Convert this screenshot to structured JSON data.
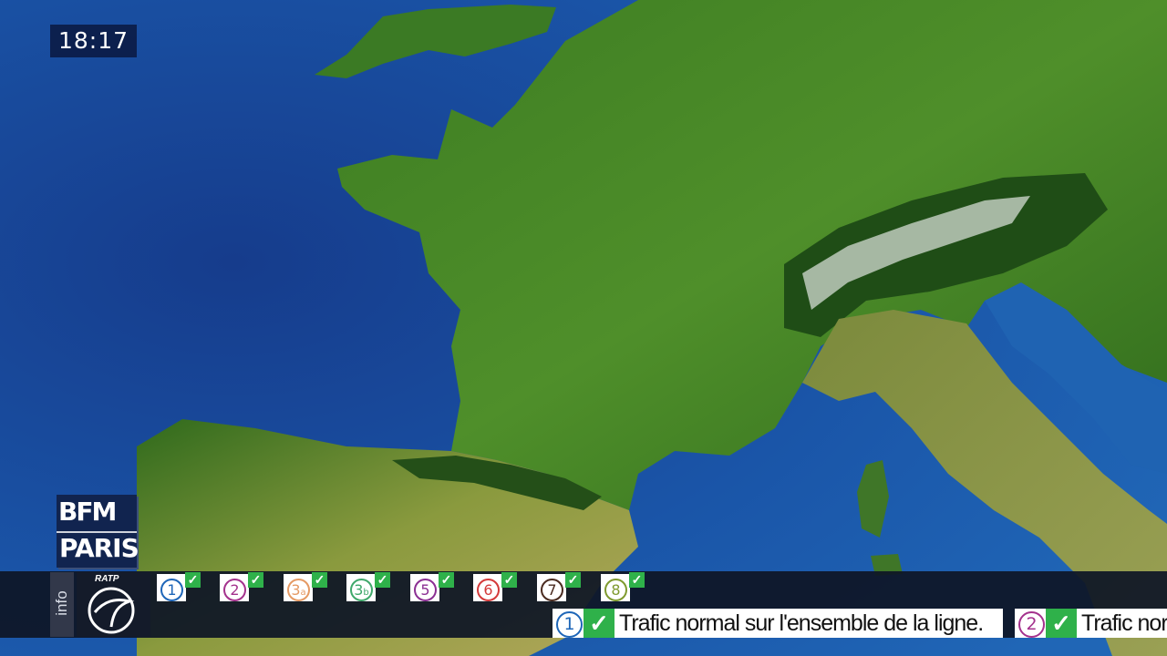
{
  "clock": {
    "time": "18:17"
  },
  "logo": {
    "line1": "BFM",
    "line2": "PARIS"
  },
  "ticker": {
    "info_label": "info",
    "operator": "RATP",
    "lines": [
      {
        "number": "1",
        "suffix": "",
        "color": "#1e66b8",
        "status": "ok"
      },
      {
        "number": "2",
        "suffix": "",
        "color": "#a4328d",
        "status": "ok"
      },
      {
        "number": "3",
        "suffix": "a",
        "color": "#e59a64",
        "status": "ok"
      },
      {
        "number": "3",
        "suffix": "b",
        "color": "#3fa86b",
        "status": "ok"
      },
      {
        "number": "5",
        "suffix": "",
        "color": "#8b2f93",
        "status": "ok"
      },
      {
        "number": "6",
        "suffix": "",
        "color": "#d43a3a",
        "status": "ok"
      },
      {
        "number": "7",
        "suffix": "",
        "color": "#4a2b20",
        "status": "ok"
      },
      {
        "number": "8",
        "suffix": "",
        "color": "#7f9a2f",
        "status": "ok"
      }
    ],
    "messages": [
      {
        "line": "1",
        "color": "#1e66b8",
        "text": "Trafic normal sur l'ensemble de la ligne."
      },
      {
        "line": "2",
        "color": "#a4328d",
        "text": "Trafic norm"
      }
    ],
    "check_color": "#2fb14a"
  }
}
